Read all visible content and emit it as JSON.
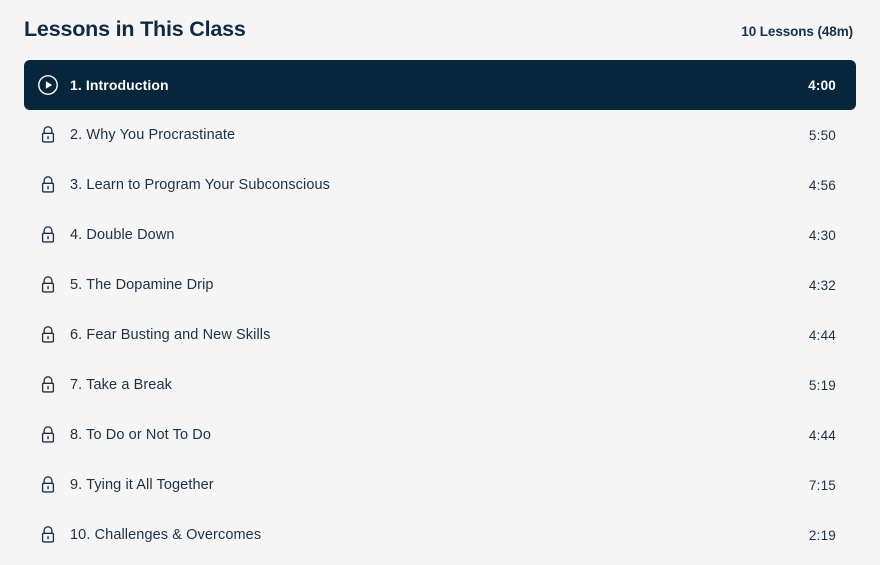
{
  "header": {
    "title": "Lessons in This Class",
    "summary": "10 Lessons (48m)"
  },
  "theme": {
    "page_background": "#f5f5f6",
    "active_row_background": "#07263b",
    "text_color": "#1d3144",
    "active_text_color": "#ffffff",
    "title_color": "#102a43"
  },
  "lessons": [
    {
      "index": "1.",
      "label": "1. Introduction",
      "title": "Introduction",
      "duration": "4:00",
      "state": "playing",
      "icon": "play-circle-icon",
      "active": true
    },
    {
      "index": "2.",
      "label": "2. Why You Procrastinate",
      "title": "Why You Procrastinate",
      "duration": "5:50",
      "state": "locked",
      "icon": "lock-icon",
      "active": false
    },
    {
      "index": "3.",
      "label": "3. Learn to Program Your Subconscious",
      "title": "Learn to Program Your Subconscious",
      "duration": "4:56",
      "state": "locked",
      "icon": "lock-icon",
      "active": false
    },
    {
      "index": "4.",
      "label": "4. Double Down",
      "title": "Double Down",
      "duration": "4:30",
      "state": "locked",
      "icon": "lock-icon",
      "active": false
    },
    {
      "index": "5.",
      "label": "5. The Dopamine Drip",
      "title": "The Dopamine Drip",
      "duration": "4:32",
      "state": "locked",
      "icon": "lock-icon",
      "active": false
    },
    {
      "index": "6.",
      "label": "6. Fear Busting and New Skills",
      "title": "Fear Busting and New Skills",
      "duration": "4:44",
      "state": "locked",
      "icon": "lock-icon",
      "active": false
    },
    {
      "index": "7.",
      "label": "7. Take a Break",
      "title": "Take a Break",
      "duration": "5:19",
      "state": "locked",
      "icon": "lock-icon",
      "active": false
    },
    {
      "index": "8.",
      "label": "8. To Do or Not To Do",
      "title": "To Do or Not To Do",
      "duration": "4:44",
      "state": "locked",
      "icon": "lock-icon",
      "active": false
    },
    {
      "index": "9.",
      "label": "9. Tying it All Together",
      "title": "Tying it All Together",
      "duration": "7:15",
      "state": "locked",
      "icon": "lock-icon",
      "active": false
    },
    {
      "index": "10.",
      "label": "10. Challenges & Overcomes",
      "title": "Challenges & Overcomes",
      "duration": "2:19",
      "state": "locked",
      "icon": "lock-icon",
      "active": false
    }
  ]
}
